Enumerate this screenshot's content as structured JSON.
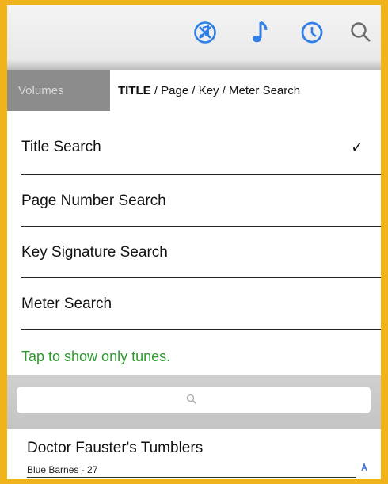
{
  "toolbar": {
    "icons": [
      "no-music-circle-icon",
      "music-note-icon",
      "clock-icon",
      "search-icon"
    ],
    "accent_color": "#2f7fe6"
  },
  "segments": {
    "volumes_label": "Volumes",
    "active_bold": "TITLE",
    "active_rest": " / Page / Key / Meter Search"
  },
  "menu": {
    "items": [
      {
        "label": "Title Search",
        "checked": "✓"
      },
      {
        "label": "Page Number Search"
      },
      {
        "label": "Key Signature Search"
      },
      {
        "label": "Meter Search"
      }
    ],
    "tap_hint": "Tap to show only tunes.",
    "tap_hint_color": "#2e9a2e"
  },
  "search": {
    "placeholder": ""
  },
  "tunes": [
    {
      "title": "Doctor Fauster's Tumblers",
      "subtitle": "Blue Barnes - 27"
    }
  ],
  "frame_color": "#f1b31c"
}
